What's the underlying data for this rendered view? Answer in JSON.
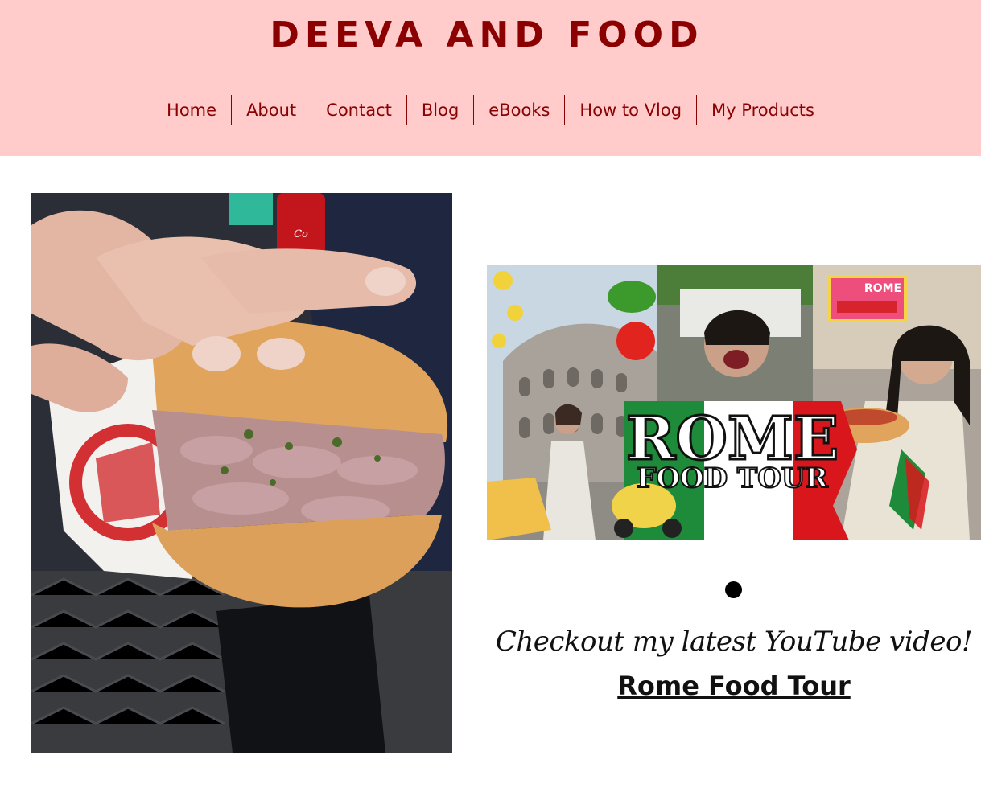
{
  "site": {
    "title": "DEEVA AND FOOD"
  },
  "nav": {
    "items": [
      {
        "label": "Home"
      },
      {
        "label": "About"
      },
      {
        "label": "Contact"
      },
      {
        "label": "Blog"
      },
      {
        "label": "eBooks"
      },
      {
        "label": "How to Vlog"
      },
      {
        "label": "My Products"
      }
    ]
  },
  "video": {
    "thumbnail_title": "ROME",
    "thumbnail_subtitle": "FOOD TOUR",
    "stamp_text": "ROME",
    "cta_text": "Checkout my latest YouTube video!",
    "link_text": "Rome Food Tour"
  },
  "colors": {
    "header_bg": "#ffcbcb",
    "brand": "#8b0000",
    "italy_green": "#1e8b3a",
    "italy_red": "#d9161b"
  }
}
